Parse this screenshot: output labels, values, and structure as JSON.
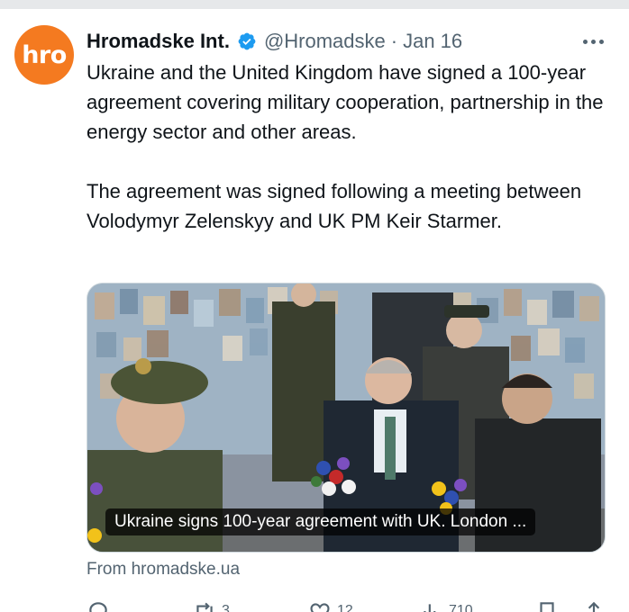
{
  "tweet": {
    "avatar_text": "hro",
    "author_name": "Hromadske Int.",
    "handle": "@Hromadske",
    "separator": "·",
    "date": "Jan 16",
    "paragraph_1": "Ukraine and the United Kingdom have signed a 100-year agreement covering military cooperation, partnership in the energy sector and other areas.",
    "paragraph_2": "The agreement was signed following a meeting between Volodymyr Zelenskyy and UK PM Keir Starmer.",
    "card_caption": "Ukraine signs 100-year agreement with UK. London ...",
    "card_source": "From hromadske.ua"
  },
  "actions": [
    {
      "name": "reply-icon",
      "count": ""
    },
    {
      "name": "retweet-icon",
      "count": "3"
    },
    {
      "name": "like-icon",
      "count": "12"
    },
    {
      "name": "views-icon",
      "count": "710"
    },
    {
      "name": "bookmark-icon",
      "count": ""
    },
    {
      "name": "share-icon",
      "count": ""
    }
  ],
  "colors": {
    "avatar_bg": "#f47a20",
    "verified_badge": "#1d9bf0",
    "text_primary": "#0f1419",
    "text_secondary": "#536471"
  }
}
